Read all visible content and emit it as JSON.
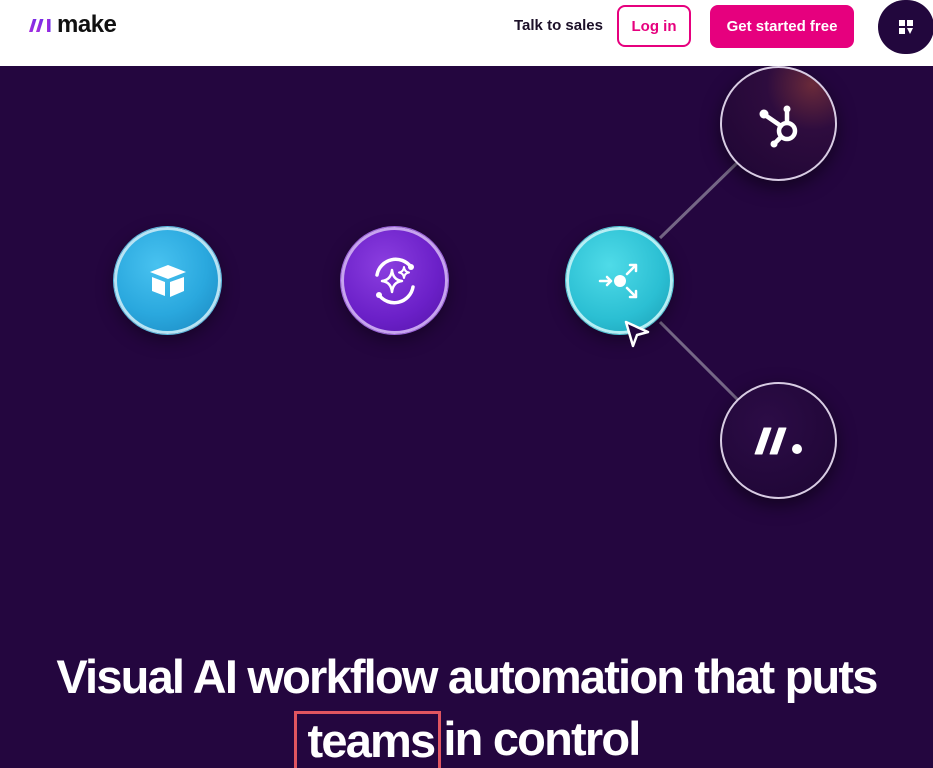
{
  "header": {
    "logo_text": "make",
    "logo_icon": "make-logo-icon",
    "talk_to_sales": "Talk to sales",
    "login": "Log in",
    "get_started": "Get started free",
    "menu_icon": "grid-menu-icon"
  },
  "hero": {
    "nodes": [
      {
        "name": "airtable",
        "icon": "airtable-icon",
        "color": "#2aa8de"
      },
      {
        "name": "ai-agent",
        "icon": "ai-sparkle-icon",
        "color": "#6b20c8"
      },
      {
        "name": "router",
        "icon": "router-icon",
        "color": "#2bbfd3"
      },
      {
        "name": "hubspot",
        "icon": "hubspot-icon",
        "color": "#1d0533"
      },
      {
        "name": "make",
        "icon": "make-icon",
        "color": "#1d0533"
      }
    ],
    "headline_line1": "Visual AI workflow automation that puts",
    "headline_highlight": "teams",
    "headline_line2_rest": "in control"
  },
  "colors": {
    "brand": "#e6007e",
    "hero_bg": "#24063f",
    "highlight_box": "#e05560"
  }
}
